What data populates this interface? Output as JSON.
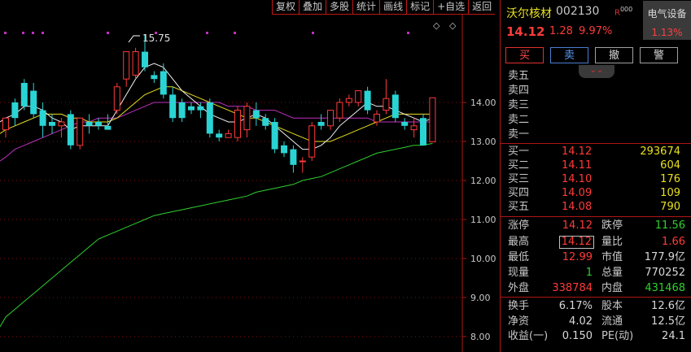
{
  "toolbar": {
    "items": [
      "复权",
      "叠加",
      "多股",
      "统计",
      "画线",
      "标记",
      "+自选",
      "返回"
    ]
  },
  "stock": {
    "name": "沃尔核材",
    "code": "002130",
    "tag": "R",
    "tag_suffix": "000",
    "sector": "电气设备",
    "sector_pct": "1.13%",
    "price": "14.12",
    "change": "1.28",
    "change_pct": "9.97%"
  },
  "actions": {
    "buy": "买",
    "sell": "卖",
    "cancel": "撤",
    "alert": "警"
  },
  "asks": [
    {
      "label": "卖五"
    },
    {
      "label": "卖四"
    },
    {
      "label": "卖三"
    },
    {
      "label": "卖二"
    },
    {
      "label": "卖一"
    }
  ],
  "bids": [
    {
      "label": "买一",
      "price": "14.12",
      "vol": "293674"
    },
    {
      "label": "买二",
      "price": "14.11",
      "vol": "604"
    },
    {
      "label": "买三",
      "price": "14.10",
      "vol": "176"
    },
    {
      "label": "买四",
      "price": "14.09",
      "vol": "109"
    },
    {
      "label": "买五",
      "price": "14.08",
      "vol": "790"
    }
  ],
  "stats": {
    "limit_up_label": "涨停",
    "limit_up": "14.12",
    "limit_down_label": "跌停",
    "limit_down": "11.56",
    "high_label": "最高",
    "high": "14.12",
    "vol_ratio_label": "量比",
    "vol_ratio": "1.66",
    "low_label": "最低",
    "low": "12.99",
    "mkt_cap_label": "市值",
    "mkt_cap": "177.9亿",
    "cur_vol_label": "现量",
    "cur_vol": "1",
    "total_vol_label": "总量",
    "total_vol": "770252",
    "outer_label": "外盘",
    "outer": "338784",
    "inner_label": "内盘",
    "inner": "431468",
    "turnover_label": "换手",
    "turnover": "6.17%",
    "shares_label": "股本",
    "shares": "12.6亿",
    "nav_label": "净资",
    "nav": "4.02",
    "float_label": "流通",
    "float": "12.5亿",
    "eps_label": "收益(一)",
    "eps": "0.150",
    "pe_label": "PE(动)",
    "pe": "24.1"
  },
  "colors": {
    "up": "#ff3a3a",
    "down": "#2ad4d4",
    "ma5": "#f0f0f0",
    "ma10": "#e8e020",
    "ma20": "#c030c0",
    "ma60": "#30d030",
    "grid": "#8a1010"
  },
  "chart_data": {
    "type": "candlestick",
    "yaxis_ticks": [
      "14.00",
      "13.00",
      "12.00",
      "11.00",
      "10.00",
      "9.00",
      "8.00"
    ],
    "ylim": [
      7.8,
      15.9
    ],
    "annotation": "15.75",
    "candles": [
      {
        "o": 13.3,
        "h": 13.6,
        "l": 13.1,
        "c": 13.6
      },
      {
        "o": 14.0,
        "h": 14.1,
        "l": 13.4,
        "c": 13.6
      },
      {
        "o": 14.5,
        "h": 14.6,
        "l": 13.8,
        "c": 13.9
      },
      {
        "o": 14.3,
        "h": 14.5,
        "l": 13.6,
        "c": 13.7
      },
      {
        "o": 13.8,
        "h": 14.0,
        "l": 13.1,
        "c": 13.4
      },
      {
        "o": 13.5,
        "h": 13.7,
        "l": 13.2,
        "c": 13.4
      },
      {
        "o": 13.4,
        "h": 13.6,
        "l": 13.1,
        "c": 13.5
      },
      {
        "o": 13.7,
        "h": 13.8,
        "l": 12.8,
        "c": 12.9
      },
      {
        "o": 12.9,
        "h": 13.6,
        "l": 12.8,
        "c": 13.6
      },
      {
        "o": 13.5,
        "h": 13.7,
        "l": 13.2,
        "c": 13.4
      },
      {
        "o": 13.5,
        "h": 13.6,
        "l": 13.3,
        "c": 13.4
      },
      {
        "o": 13.4,
        "h": 13.7,
        "l": 13.3,
        "c": 13.3
      },
      {
        "o": 13.8,
        "h": 14.5,
        "l": 13.7,
        "c": 14.4
      },
      {
        "o": 14.6,
        "h": 15.3,
        "l": 14.4,
        "c": 15.3
      },
      {
        "o": 14.7,
        "h": 15.4,
        "l": 14.6,
        "c": 15.3
      },
      {
        "o": 15.3,
        "h": 15.75,
        "l": 14.8,
        "c": 14.9
      },
      {
        "o": 14.7,
        "h": 14.8,
        "l": 14.5,
        "c": 14.6
      },
      {
        "o": 14.8,
        "h": 15.0,
        "l": 14.1,
        "c": 14.2
      },
      {
        "o": 14.2,
        "h": 14.4,
        "l": 13.5,
        "c": 13.6
      },
      {
        "o": 14.0,
        "h": 14.1,
        "l": 13.5,
        "c": 13.6
      },
      {
        "o": 13.9,
        "h": 14.0,
        "l": 13.7,
        "c": 13.8
      },
      {
        "o": 13.9,
        "h": 14.0,
        "l": 13.6,
        "c": 13.8
      },
      {
        "o": 14.0,
        "h": 14.1,
        "l": 13.1,
        "c": 13.2
      },
      {
        "o": 13.2,
        "h": 13.3,
        "l": 13.0,
        "c": 13.1
      },
      {
        "o": 13.1,
        "h": 13.3,
        "l": 13.1,
        "c": 13.2
      },
      {
        "o": 13.1,
        "h": 13.9,
        "l": 13.0,
        "c": 13.8
      },
      {
        "o": 13.3,
        "h": 14.0,
        "l": 13.1,
        "c": 13.9
      },
      {
        "o": 13.8,
        "h": 14.0,
        "l": 13.4,
        "c": 13.6
      },
      {
        "o": 13.6,
        "h": 13.7,
        "l": 13.3,
        "c": 13.4
      },
      {
        "o": 13.5,
        "h": 13.6,
        "l": 12.7,
        "c": 12.8
      },
      {
        "o": 12.9,
        "h": 13.0,
        "l": 12.6,
        "c": 12.7
      },
      {
        "o": 12.8,
        "h": 12.9,
        "l": 12.2,
        "c": 12.4
      },
      {
        "o": 12.5,
        "h": 12.6,
        "l": 12.2,
        "c": 12.5
      },
      {
        "o": 12.6,
        "h": 13.5,
        "l": 12.5,
        "c": 13.4
      },
      {
        "o": 13.5,
        "h": 13.7,
        "l": 13.3,
        "c": 13.4
      },
      {
        "o": 13.4,
        "h": 13.8,
        "l": 13.3,
        "c": 13.8
      },
      {
        "o": 13.6,
        "h": 14.1,
        "l": 13.5,
        "c": 14.0
      },
      {
        "o": 14.0,
        "h": 14.2,
        "l": 13.9,
        "c": 14.1
      },
      {
        "o": 14.0,
        "h": 14.3,
        "l": 13.9,
        "c": 14.3
      },
      {
        "o": 14.3,
        "h": 14.4,
        "l": 13.7,
        "c": 13.8
      },
      {
        "o": 13.5,
        "h": 13.8,
        "l": 13.4,
        "c": 13.7
      },
      {
        "o": 13.8,
        "h": 14.6,
        "l": 13.7,
        "c": 14.1
      },
      {
        "o": 14.2,
        "h": 14.3,
        "l": 13.5,
        "c": 13.6
      },
      {
        "o": 13.5,
        "h": 13.6,
        "l": 13.3,
        "c": 13.4
      },
      {
        "o": 13.3,
        "h": 13.6,
        "l": 13.1,
        "c": 13.4
      },
      {
        "o": 13.6,
        "h": 13.7,
        "l": 12.9,
        "c": 12.9
      },
      {
        "o": 12.99,
        "h": 14.12,
        "l": 12.99,
        "c": 14.12
      }
    ],
    "ma5": [
      13.6,
      13.7,
      13.9,
      13.9,
      13.8,
      13.6,
      13.5,
      13.3,
      13.4,
      13.4,
      13.4,
      13.4,
      13.8,
      14.2,
      14.6,
      14.9,
      15.0,
      14.9,
      14.6,
      14.3,
      14.1,
      13.9,
      13.7,
      13.6,
      13.5,
      13.5,
      13.6,
      13.7,
      13.6,
      13.4,
      13.2,
      13.0,
      12.8,
      12.8,
      12.9,
      13.1,
      13.4,
      13.6,
      13.8,
      14.0,
      13.9,
      13.9,
      13.8,
      13.7,
      13.6,
      13.5,
      13.6
    ],
    "ma10": [
      13.3,
      13.4,
      13.5,
      13.6,
      13.7,
      13.7,
      13.7,
      13.6,
      13.6,
      13.5,
      13.5,
      13.5,
      13.6,
      13.8,
      14.0,
      14.2,
      14.3,
      14.4,
      14.4,
      14.3,
      14.2,
      14.1,
      14.0,
      13.9,
      13.8,
      13.7,
      13.6,
      13.6,
      13.5,
      13.4,
      13.3,
      13.2,
      13.1,
      13.0,
      13.0,
      13.0,
      13.1,
      13.2,
      13.3,
      13.4,
      13.5,
      13.6,
      13.7,
      13.7,
      13.7,
      13.7,
      13.7
    ],
    "ma20": [
      12.6,
      12.8,
      12.9,
      13.0,
      13.1,
      13.2,
      13.3,
      13.4,
      13.5,
      13.5,
      13.6,
      13.6,
      13.6,
      13.7,
      13.8,
      13.9,
      14.0,
      14.0,
      14.0,
      14.0,
      14.0,
      14.0,
      14.0,
      14.0,
      13.9,
      13.9,
      13.9,
      13.8,
      13.8,
      13.8,
      13.7,
      13.6,
      13.6,
      13.6,
      13.6,
      13.6,
      13.6,
      13.6,
      13.6,
      13.6,
      13.5,
      13.5,
      13.5,
      13.5,
      13.5,
      13.5,
      13.5
    ],
    "ma60": [
      8.5,
      8.7,
      8.9,
      9.1,
      9.3,
      9.5,
      9.7,
      9.9,
      10.1,
      10.3,
      10.5,
      10.6,
      10.7,
      10.8,
      10.9,
      11.0,
      11.1,
      11.15,
      11.2,
      11.25,
      11.3,
      11.35,
      11.4,
      11.45,
      11.5,
      11.55,
      11.6,
      11.7,
      11.75,
      11.8,
      11.85,
      11.9,
      12.0,
      12.05,
      12.1,
      12.2,
      12.3,
      12.4,
      12.5,
      12.6,
      12.7,
      12.75,
      12.8,
      12.85,
      12.9,
      12.9,
      12.95
    ]
  }
}
